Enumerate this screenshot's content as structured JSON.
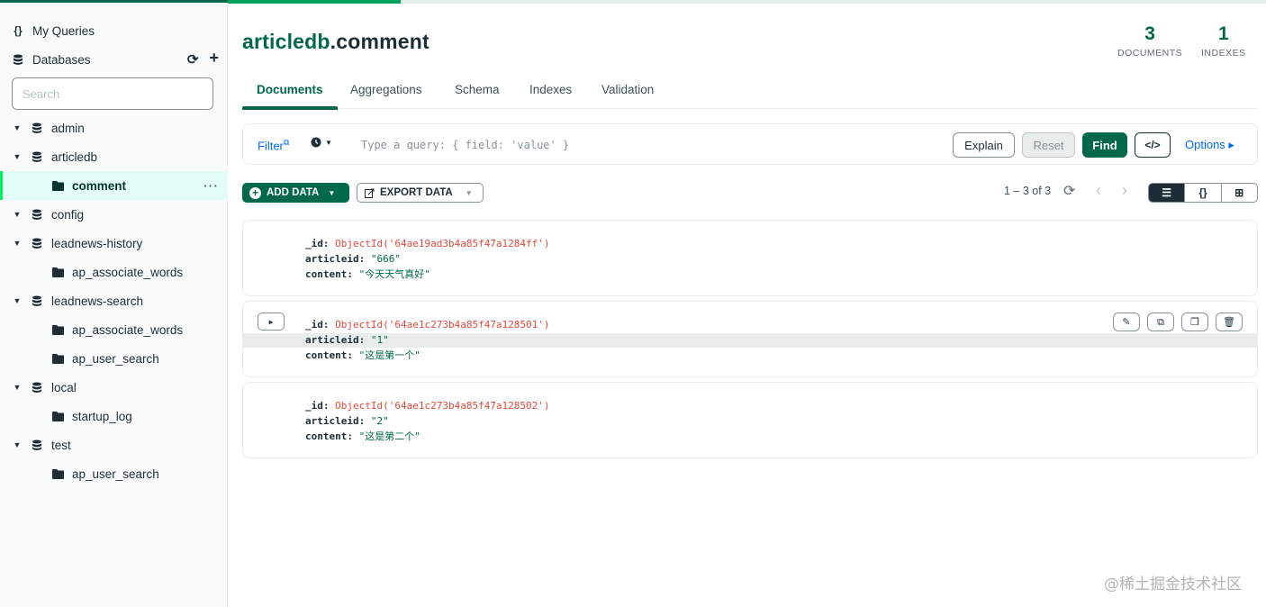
{
  "sidebar": {
    "my_queries": {
      "icon": "{}",
      "label": "My Queries"
    },
    "databases": {
      "label": "Databases",
      "refresh_icon": "⟳",
      "add_icon": "+"
    },
    "search": {
      "placeholder": "Search"
    },
    "tree": [
      {
        "type": "db",
        "label": "admin"
      },
      {
        "type": "db",
        "label": "articledb"
      },
      {
        "type": "coll",
        "label": "comment",
        "active": true
      },
      {
        "type": "db",
        "label": "config"
      },
      {
        "type": "db",
        "label": "leadnews-history"
      },
      {
        "type": "coll",
        "label": "ap_associate_words"
      },
      {
        "type": "db",
        "label": "leadnews-search"
      },
      {
        "type": "coll",
        "label": "ap_associate_words"
      },
      {
        "type": "coll",
        "label": "ap_user_search"
      },
      {
        "type": "db",
        "label": "local"
      },
      {
        "type": "coll",
        "label": "startup_log"
      },
      {
        "type": "db",
        "label": "test"
      },
      {
        "type": "coll",
        "label": "ap_user_search"
      }
    ],
    "more_icon": "···"
  },
  "header": {
    "db": "articledb",
    "collection": ".comment",
    "documents_count": "3",
    "documents_label": "DOCUMENTS",
    "indexes_count": "1",
    "indexes_label": "INDEXES"
  },
  "tabs": [
    "Documents",
    "Aggregations",
    "Schema",
    "Indexes",
    "Validation"
  ],
  "query": {
    "filter_label": "Filter",
    "external_icon": "⧉",
    "history_icon": "🕓",
    "placeholder": "Type a query: { field: 'value' }",
    "explain": "Explain",
    "reset": "Reset",
    "find": "Find",
    "code_icon": "</>",
    "options": "Options ▸"
  },
  "toolbar": {
    "add_data": "ADD DATA",
    "export_data": "EXPORT DATA",
    "pager": "1 – 3 of 3",
    "refresh_icon": "⟳",
    "prev_icon": "‹",
    "next_icon": "›",
    "view_list_icon": "☰",
    "view_json_icon": "{}",
    "view_table_icon": "⊞"
  },
  "documents": [
    {
      "id_key": "_id:",
      "id_val": "ObjectId('64ae19ad3b4a85f47a1284ff')",
      "a_key": "articleid:",
      "a_val": "\"666\"",
      "c_key": "content:",
      "c_val": "\"今天天气真好\""
    },
    {
      "id_key": "_id:",
      "id_val": "ObjectId('64ae1c273b4a85f47a128501')",
      "a_key": "articleid:",
      "a_val": "\"1\"",
      "c_key": "content:",
      "c_val": "\"这是第一个\""
    },
    {
      "id_key": "_id:",
      "id_val": "ObjectId('64ae1c273b4a85f47a128502')",
      "a_key": "articleid:",
      "a_val": "\"2\"",
      "c_key": "content:",
      "c_val": "\"这是第二个\""
    }
  ],
  "doc_actions": {
    "edit_icon": "✎",
    "copy_icon": "⧉",
    "clone_icon": "❐",
    "delete_icon": "🗑"
  },
  "watermark": "@稀土掘金技术社区"
}
